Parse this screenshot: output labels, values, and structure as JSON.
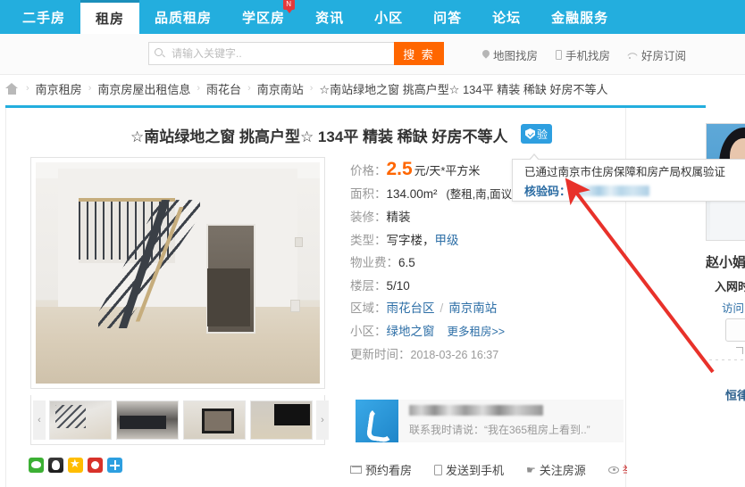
{
  "nav": {
    "items": [
      {
        "label": "二手房",
        "active": false,
        "badge": null
      },
      {
        "label": "租房",
        "active": true,
        "badge": null
      },
      {
        "label": "品质租房",
        "active": false,
        "badge": null
      },
      {
        "label": "学区房",
        "active": false,
        "badge": "N"
      },
      {
        "label": "资讯",
        "active": false,
        "badge": null
      },
      {
        "label": "小区",
        "active": false,
        "badge": null
      },
      {
        "label": "问答",
        "active": false,
        "badge": null
      },
      {
        "label": "论坛",
        "active": false,
        "badge": null
      },
      {
        "label": "金融服务",
        "active": false,
        "badge": null
      }
    ],
    "accent_color": "#23aede",
    "badge_color": "#e4393c"
  },
  "search": {
    "placeholder": "请输入关键字..",
    "value": "",
    "button_label": "搜 索",
    "button_color": "#ff6600",
    "links": [
      {
        "label": "地图找房",
        "icon": "map-pin-icon"
      },
      {
        "label": "手机找房",
        "icon": "mobile-icon"
      },
      {
        "label": "好房订阅",
        "icon": "rss-icon"
      }
    ]
  },
  "breadcrumb": {
    "home_icon": "home-icon",
    "separator": "›",
    "items": [
      "南京租房",
      "南京房屋出租信息",
      "雨花台",
      "南京南站",
      "☆南站绿地之窗 挑高户型☆ 134平 精装 稀缺 好房不等人"
    ]
  },
  "listing": {
    "title": "☆南站绿地之窗 挑高户型☆ 134平 精装 稀缺 好房不等人",
    "verify_badge": {
      "label": "验",
      "icon": "shield-check-icon",
      "color": "#2e9fe0"
    },
    "verify_tooltip": {
      "line1": "已通过南京市住房保障和房产局权属验证",
      "code_label": "核验码：",
      "code_value": "",
      "code_masked": true
    },
    "details": [
      {
        "label": "价格：",
        "value": "2.5",
        "unit": "元/天*平方米",
        "highlight": true
      },
      {
        "label": "面积：",
        "value": "134.00",
        "unit": "m²",
        "extra": "(整租,南,面议"
      },
      {
        "label": "装修：",
        "value": "精装"
      },
      {
        "label": "类型：",
        "value": "写字楼",
        "link": "甲级"
      },
      {
        "label": "物业费：",
        "value": "6.5"
      },
      {
        "label": "楼层：",
        "value": "5/10"
      },
      {
        "label": "区域：",
        "link1": "雨花台区",
        "sep": "/",
        "link2": "南京南站"
      },
      {
        "label": "小区：",
        "link1": "绿地之窗",
        "more": "更多租房>>"
      },
      {
        "label": "更新时间：",
        "value": "2018-03-26 16:37",
        "muted": true
      }
    ]
  },
  "gallery": {
    "main_photo_alt": "室内客厅带楼梯",
    "prev_arrow": "‹",
    "next_arrow": "›",
    "thumbs": [
      {
        "alt": "楼梯"
      },
      {
        "alt": "大堂"
      },
      {
        "alt": "卫生间"
      },
      {
        "alt": "落地窗"
      }
    ]
  },
  "share": {
    "icons": [
      {
        "name": "wechat-icon"
      },
      {
        "name": "qq-icon"
      },
      {
        "name": "qzone-icon"
      },
      {
        "name": "weibo-icon"
      },
      {
        "name": "more-share-icon"
      }
    ]
  },
  "contact": {
    "phone_icon": "phone-icon",
    "phone_masked": true,
    "phone_value": "",
    "note": "联系我时请说：“我在365租房上看到..”"
  },
  "actions": [
    {
      "label": "预约看房",
      "icon": "mail-icon",
      "color": "#444444"
    },
    {
      "label": "发送到手机",
      "icon": "mobile-icon",
      "color": "#444444"
    },
    {
      "label": "关注房源",
      "icon": "hand-icon",
      "color": "#444444"
    },
    {
      "label": "举报",
      "icon": "eye-icon",
      "color": "#c62828"
    }
  ],
  "sidebar": {
    "agent_photo_alt": "经纪人照片",
    "agent_name": "赵小娟",
    "agent_star": "★",
    "line2": "入网时",
    "line3": "访问",
    "bottom_text": "恒律"
  }
}
